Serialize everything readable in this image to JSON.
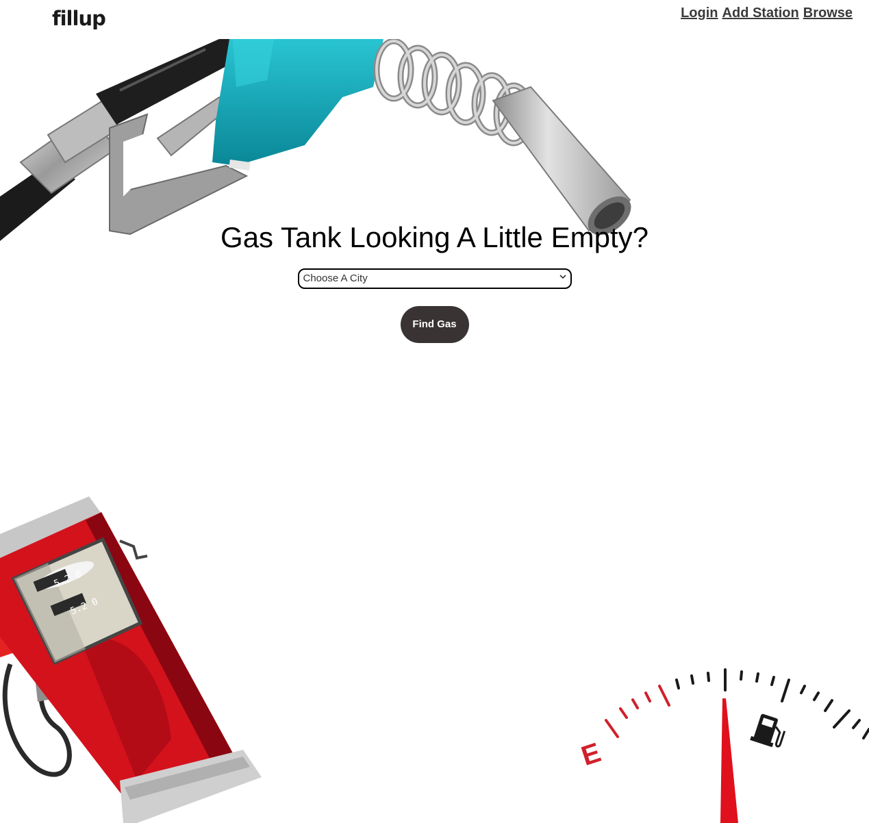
{
  "header": {
    "logo": "fillup",
    "nav": [
      {
        "label": "Login"
      },
      {
        "label": "Add Station"
      },
      {
        "label": "Browse"
      }
    ]
  },
  "hero": {
    "title": "Gas Tank Looking A Little Empty?",
    "city_select": {
      "selected": "Choose A City"
    },
    "find_button": "Find Gas"
  },
  "illustrations": {
    "pump_display_top": "5.2 0",
    "pump_display_bottom": "5.2 0",
    "gauge_label": "E"
  },
  "colors": {
    "button_bg": "#393433",
    "nozzle_teal": "#1aa8b8",
    "pump_red": "#d4121c",
    "gauge_red": "#d0202a"
  }
}
